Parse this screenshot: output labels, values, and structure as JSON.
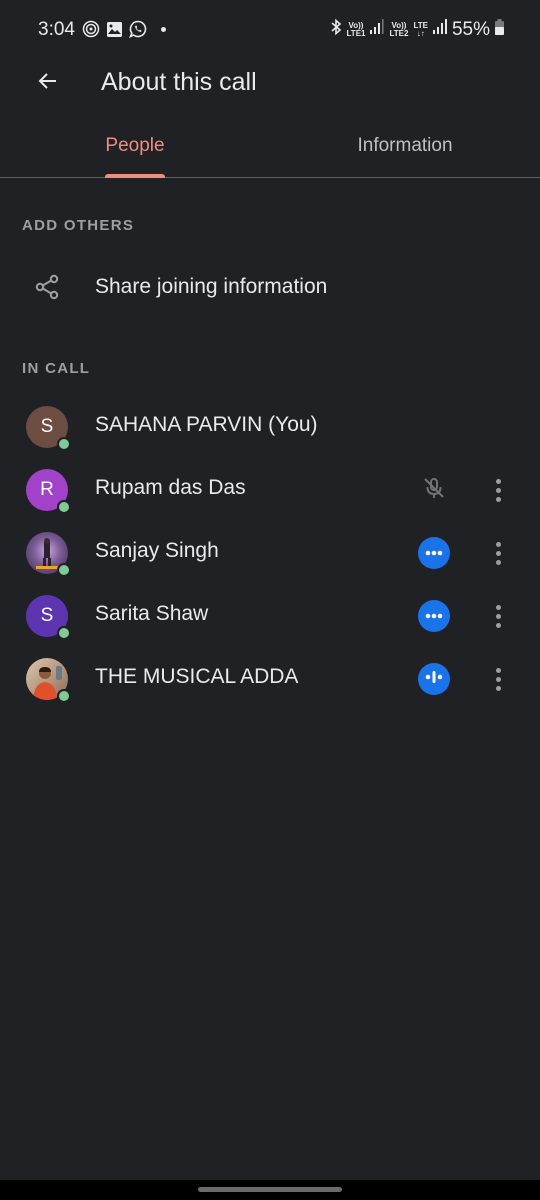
{
  "status_bar": {
    "time": "3:04",
    "left_icons": [
      "hotspot-icon",
      "gallery-icon",
      "whatsapp-icon",
      "notification-dot"
    ],
    "sim1_top": "Vo))",
    "sim1_bottom": "LTE1",
    "sim2_top": "Vo))",
    "sim2_bottom": "LTE2",
    "network_top": "LTE",
    "network_bottom": "↓↑",
    "battery": "55%"
  },
  "app_bar": {
    "title": "About this call",
    "back_icon": "arrow-back-icon"
  },
  "tabs": [
    {
      "label": "People",
      "selected": true
    },
    {
      "label": "Information",
      "selected": false
    }
  ],
  "sections": {
    "add_others": "ADD OTHERS",
    "share_label": "Share joining information",
    "in_call": "IN CALL"
  },
  "participants": [
    {
      "name": "SAHANA PARVIN (You)",
      "initial": "S",
      "avatar_color": "#6d4c41",
      "status": "none",
      "has_more": false
    },
    {
      "name": "Rupam das Das",
      "initial": "R",
      "avatar_color": "#a142c8",
      "status": "muted",
      "has_more": true
    },
    {
      "name": "Sanjay Singh",
      "initial": "",
      "avatar_color": "",
      "status": "ellipsis",
      "has_more": true
    },
    {
      "name": "Sarita Shaw",
      "initial": "S",
      "avatar_color": "#5e35b1",
      "status": "ellipsis",
      "has_more": true
    },
    {
      "name": "THE MUSICAL ADDA",
      "initial": "",
      "avatar_color": "",
      "status": "speaking",
      "has_more": true
    }
  ],
  "colors": {
    "accent": "#f28b82",
    "presence": "#81c995",
    "status_blue": "#1a73e8",
    "background": "#202124"
  }
}
